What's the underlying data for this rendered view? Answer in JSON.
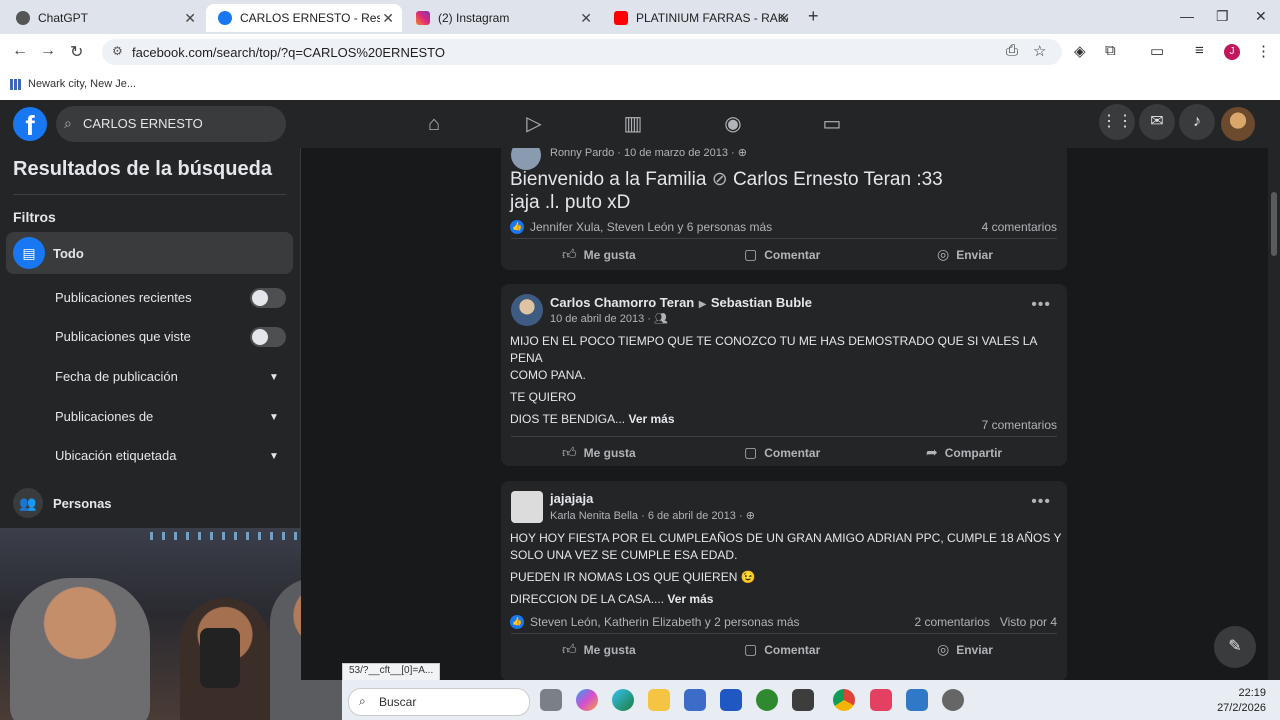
{
  "browser": {
    "tabs": [
      {
        "title": "ChatGPT"
      },
      {
        "title": "CARLOS ERNESTO - Resultados"
      },
      {
        "title": "(2) Instagram"
      },
      {
        "title": "PLATINIUM FARRAS - RAKATA A"
      }
    ],
    "url": "facebook.com/search/top/?q=CARLOS%20ERNESTO",
    "bookmark": "Newark city, New Je...",
    "profile_initial": "J",
    "status_url": "53/?__cft__[0]=A..."
  },
  "header": {
    "search_query": "CARLOS ERNESTO",
    "logo": "f"
  },
  "sidebar": {
    "title": "Resultados de la búsqueda",
    "filters_label": "Filtros",
    "all_label": "Todo",
    "recent_posts": "Publicaciones recientes",
    "seen_posts": "Publicaciones que viste",
    "pub_date": "Fecha de publicación",
    "posts_from": "Publicaciones de",
    "tagged_location": "Ubicación etiquetada",
    "people": "Personas"
  },
  "posts": [
    {
      "author": "Ronny Pardo",
      "date": "10 de marzo de 2013",
      "title_line1": "Bienvenido a la Familia",
      "tag": "Carlos Ernesto Teran :33",
      "title_line2": "jaja .l. puto xD",
      "reactions": "Jennifer Xula, Steven León y 6 personas más",
      "comments": "4 comentarios",
      "actions": [
        "Me gusta",
        "Comentar",
        "Enviar"
      ]
    },
    {
      "author": "Carlos Chamorro Teran",
      "target": "Sebastian Buble",
      "date": "10 de abril de 2013",
      "line1": "MIJO EN EL POCO TIEMPO QUE TE CONOZCO TU ME HAS DEMOSTRADO QUE SI VALES LA PENA",
      "line2": "COMO PANA.",
      "line3": "TE QUIERO",
      "line4": "DIOS TE BENDIGA...",
      "more": "Ver más",
      "comments": "7 comentarios",
      "actions": [
        "Me gusta",
        "Comentar",
        "Compartir"
      ]
    },
    {
      "author": "jajajaja",
      "sub_author": "Karla Nenita Bella",
      "date": "6 de abril de 2013",
      "line1": "HOY HOY FIESTA POR EL CUMPLEAÑOS DE UN GRAN AMIGO ADRIAN PPC, CUMPLE 18 AÑOS Y",
      "line2": "SOLO UNA VEZ SE CUMPLE ESA EDAD.",
      "line3": "PUEDEN IR NOMAS LOS QUE QUIEREN 😉",
      "line4": "DIRECCION DE LA CASA....",
      "more": "Ver más",
      "reactions": "Steven León, Katherin Elizabeth y 2 personas más",
      "comments": "2 comentarios",
      "seen": "Visto por 4",
      "actions": [
        "Me gusta",
        "Comentar",
        "Enviar"
      ]
    }
  ],
  "taskbar": {
    "search": "Buscar",
    "time": "22:19",
    "date": "27/2/2026"
  },
  "colors": {
    "fb_blue": "#1877f2",
    "fb_bg": "#18191a",
    "fb_card": "#242526"
  }
}
